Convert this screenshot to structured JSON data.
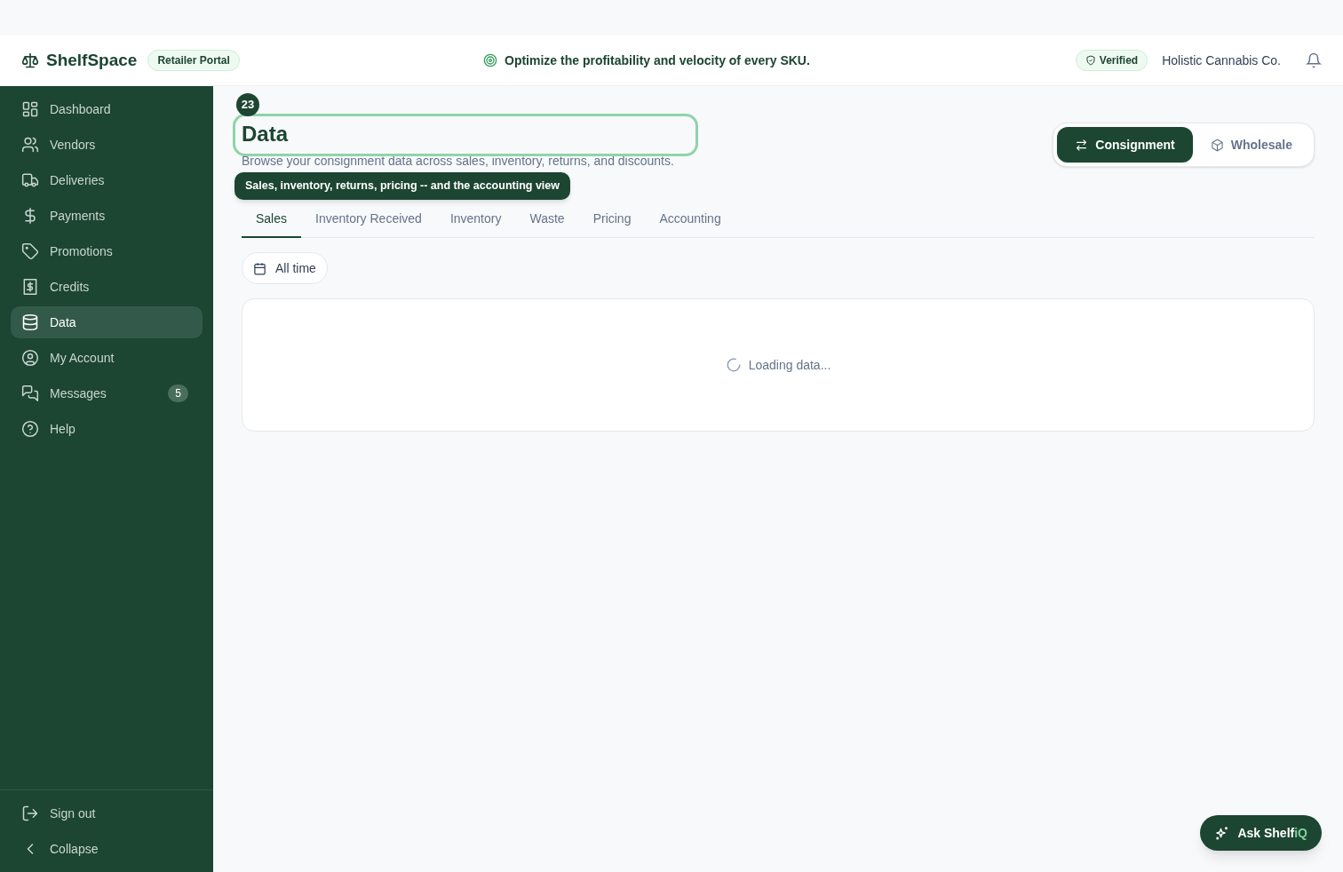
{
  "header": {
    "brand": "ShelfSpace",
    "portal_badge": "Retailer Portal",
    "tagline": "Optimize the profitability and velocity of every SKU.",
    "verified_badge": "Verified",
    "account_name": "Holistic Cannabis Co."
  },
  "sidebar": {
    "items": [
      {
        "label": "Dashboard",
        "selected": false
      },
      {
        "label": "Vendors",
        "selected": false
      },
      {
        "label": "Deliveries",
        "selected": false
      },
      {
        "label": "Payments",
        "selected": false
      },
      {
        "label": "Promotions",
        "selected": false
      },
      {
        "label": "Credits",
        "selected": false
      },
      {
        "label": "Data",
        "selected": true
      },
      {
        "label": "My Account",
        "selected": false
      },
      {
        "label": "Messages",
        "selected": false,
        "badge": "5"
      },
      {
        "label": "Help",
        "selected": false
      }
    ],
    "footer_items": [
      {
        "label": "Sign out"
      },
      {
        "label": "Collapse"
      }
    ]
  },
  "page": {
    "step_number": "23",
    "title": "Data",
    "subtitle": "Browse your consignment data across sales, inventory, returns, and discounts.",
    "tooltip": "Sales, inventory, returns, pricing -- and the accounting view",
    "mode_toggle": [
      {
        "label": "Consignment",
        "selected": true
      },
      {
        "label": "Wholesale",
        "selected": false
      }
    ],
    "tabs": [
      {
        "label": "Sales",
        "selected": true
      },
      {
        "label": "Inventory Received",
        "selected": false
      },
      {
        "label": "Inventory",
        "selected": false
      },
      {
        "label": "Waste",
        "selected": false
      },
      {
        "label": "Pricing",
        "selected": false
      },
      {
        "label": "Accounting",
        "selected": false
      }
    ],
    "date_filter": "All time",
    "loading_text": "Loading data..."
  },
  "assistant_button": {
    "label": "Ask Shelf",
    "label_accent": "iQ"
  }
}
